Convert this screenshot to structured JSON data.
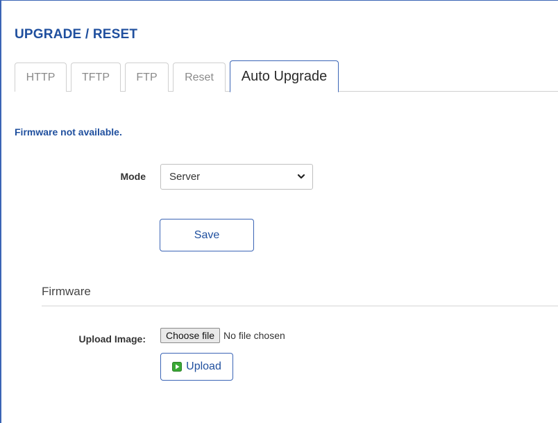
{
  "page": {
    "title": "UPGRADE / RESET"
  },
  "tabs": [
    {
      "label": "HTTP",
      "active": false
    },
    {
      "label": "TFTP",
      "active": false
    },
    {
      "label": "FTP",
      "active": false
    },
    {
      "label": "Reset",
      "active": false
    },
    {
      "label": "Auto Upgrade",
      "active": true
    }
  ],
  "status": {
    "message": "Firmware not available."
  },
  "mode": {
    "label": "Mode",
    "selected": "Server"
  },
  "buttons": {
    "save_label": "Save",
    "upload_label": "Upload",
    "choose_file_label": "Choose file"
  },
  "firmware_section": {
    "title": "Firmware",
    "upload_label": "Upload Image:",
    "file_status": "No file chosen"
  },
  "colors": {
    "accent": "#1f4f9e",
    "border_accent": "#3a64b5",
    "upload_icon": "#3aa935"
  },
  "icons": {
    "select_arrow": "chevron-down-icon",
    "upload": "upload-icon"
  }
}
